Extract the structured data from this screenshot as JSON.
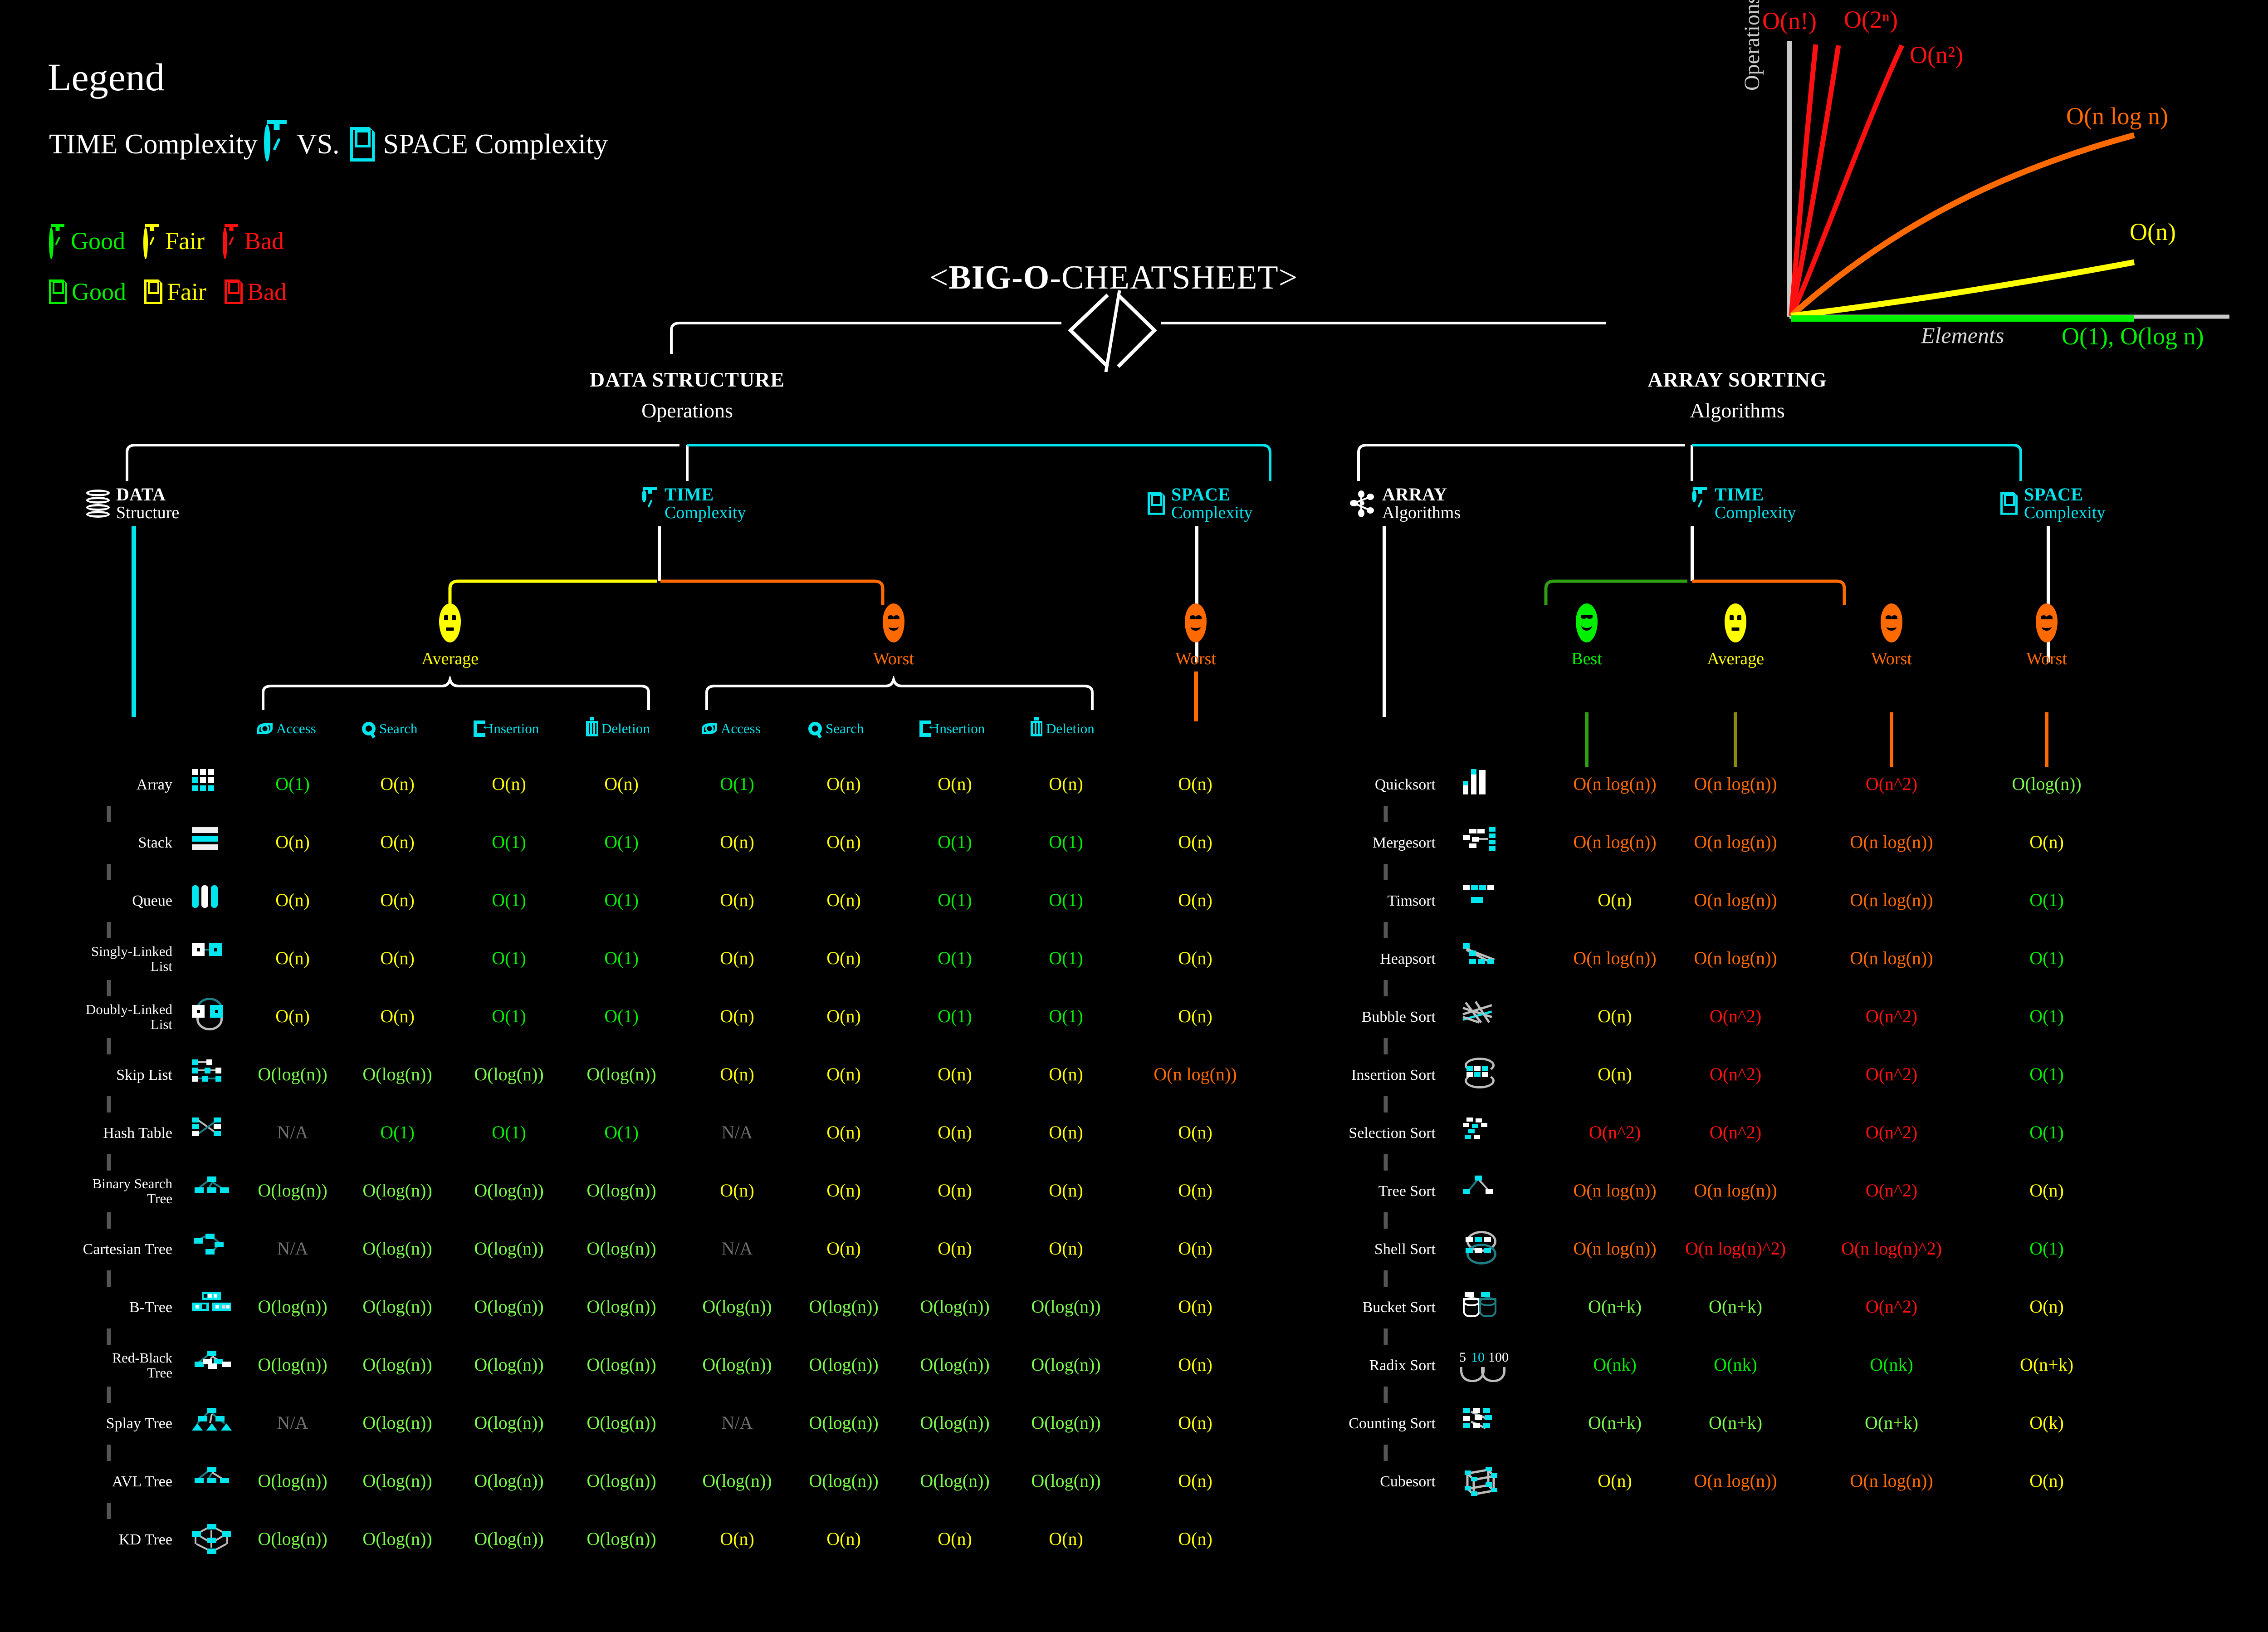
{
  "legend": {
    "title": "Legend",
    "time_label": "TIME Complexity",
    "vs": "VS.",
    "space_label": "SPACE Complexity",
    "time_icon": "stopwatch-icon",
    "space_icon": "floppy-disk-icon",
    "quality": [
      {
        "label": "Good",
        "color": "#00f000"
      },
      {
        "label": "Fair",
        "color": "#ffff00"
      },
      {
        "label": "Bad",
        "color": "#ff1010"
      }
    ]
  },
  "title": {
    "prefix": "<",
    "bold": "BIG-O",
    "rest": "-CHEATSHEET",
    "suffix": ">",
    "code_icon": "code-brackets-icon"
  },
  "chart_data": {
    "type": "line",
    "title": "",
    "xlabel": "Elements",
    "ylabel": "Operations",
    "grid": false,
    "legend_position": "inline-annotations",
    "series": [
      {
        "name": "O(n!)",
        "color": "#ff1010",
        "label_color": "#ff1010",
        "growth": "factorial"
      },
      {
        "name": "O(2ⁿ)",
        "color": "#ff1010",
        "label_color": "#ff1010",
        "growth": "exponential"
      },
      {
        "name": "O(n²)",
        "color": "#ff1010",
        "label_color": "#ff1010",
        "growth": "quadratic"
      },
      {
        "name": "O(n log n)",
        "color": "#ff6a00",
        "label_color": "#ff6a00",
        "growth": "linearithmic"
      },
      {
        "name": "O(n)",
        "color": "#ffff00",
        "label_color": "#ffff00",
        "growth": "linear"
      },
      {
        "name": "O(1), O(log n)",
        "color": "#00f000",
        "label_color": "#00f000",
        "growth": "constant"
      }
    ]
  },
  "data_structure": {
    "section_title": "DATA STRUCTURE",
    "section_sub": "Operations",
    "head_structure": {
      "t1": "DATA",
      "t2": "Structure",
      "icon": "database-drum-icon"
    },
    "head_time": {
      "t1": "TIME",
      "t2": "Complexity",
      "icon": "stopwatch-icon"
    },
    "head_space": {
      "t1": "SPACE",
      "t2": "Complexity",
      "icon": "floppy-disk-icon"
    },
    "cases": [
      {
        "label": "Average",
        "color": "#ffff00",
        "face": "neutral"
      },
      {
        "label": "Worst",
        "color": "#ff6a00",
        "face": "sad"
      },
      {
        "label": "Worst",
        "color": "#ff6a00",
        "face": "sad"
      }
    ],
    "operations": [
      "Access",
      "Search",
      "Insertion",
      "Deletion"
    ],
    "op_icons": [
      "eye-icon",
      "magnifier-icon",
      "insertion-icon",
      "deletion-icon"
    ],
    "space_col_label": "Worst",
    "rows": [
      {
        "name": "Array",
        "icon": "array-grid-icon",
        "avg": [
          "O(1)",
          "O(n)",
          "O(n)",
          "O(n)"
        ],
        "worst": [
          "O(1)",
          "O(n)",
          "O(n)",
          "O(n)"
        ],
        "space": "O(n)",
        "avg_c": [
          "g",
          "y",
          "y",
          "y"
        ],
        "worst_c": [
          "g",
          "y",
          "y",
          "y"
        ],
        "space_c": "y"
      },
      {
        "name": "Stack",
        "icon": "stack-icon",
        "avg": [
          "O(n)",
          "O(n)",
          "O(1)",
          "O(1)"
        ],
        "worst": [
          "O(n)",
          "O(n)",
          "O(1)",
          "O(1)"
        ],
        "space": "O(n)",
        "avg_c": [
          "y",
          "y",
          "g",
          "g"
        ],
        "worst_c": [
          "y",
          "y",
          "g",
          "g"
        ],
        "space_c": "y"
      },
      {
        "name": "Queue",
        "icon": "queue-icon",
        "avg": [
          "O(n)",
          "O(n)",
          "O(1)",
          "O(1)"
        ],
        "worst": [
          "O(n)",
          "O(n)",
          "O(1)",
          "O(1)"
        ],
        "space": "O(n)",
        "avg_c": [
          "y",
          "y",
          "g",
          "g"
        ],
        "worst_c": [
          "y",
          "y",
          "g",
          "g"
        ],
        "space_c": "y"
      },
      {
        "name": "Singly-Linked\nList",
        "icon": "singly-linked-list-icon",
        "avg": [
          "O(n)",
          "O(n)",
          "O(1)",
          "O(1)"
        ],
        "worst": [
          "O(n)",
          "O(n)",
          "O(1)",
          "O(1)"
        ],
        "space": "O(n)",
        "avg_c": [
          "y",
          "y",
          "g",
          "g"
        ],
        "worst_c": [
          "y",
          "y",
          "g",
          "g"
        ],
        "space_c": "y"
      },
      {
        "name": "Doubly-Linked\nList",
        "icon": "doubly-linked-list-icon",
        "avg": [
          "O(n)",
          "O(n)",
          "O(1)",
          "O(1)"
        ],
        "worst": [
          "O(n)",
          "O(n)",
          "O(1)",
          "O(1)"
        ],
        "space": "O(n)",
        "avg_c": [
          "y",
          "y",
          "g",
          "g"
        ],
        "worst_c": [
          "y",
          "y",
          "g",
          "g"
        ],
        "space_c": "y"
      },
      {
        "name": "Skip List",
        "icon": "skip-list-icon",
        "avg": [
          "O(log(n))",
          "O(log(n))",
          "O(log(n))",
          "O(log(n))"
        ],
        "worst": [
          "O(n)",
          "O(n)",
          "O(n)",
          "O(n)"
        ],
        "space": "O(n log(n))",
        "avg_c": [
          "lg",
          "lg",
          "lg",
          "lg"
        ],
        "worst_c": [
          "y",
          "y",
          "y",
          "y"
        ],
        "space_c": "o"
      },
      {
        "name": "Hash Table",
        "icon": "hash-table-icon",
        "avg": [
          "N/A",
          "O(1)",
          "O(1)",
          "O(1)"
        ],
        "worst": [
          "N/A",
          "O(n)",
          "O(n)",
          "O(n)"
        ],
        "space": "O(n)",
        "avg_c": [
          "na",
          "g",
          "g",
          "g"
        ],
        "worst_c": [
          "na",
          "y",
          "y",
          "y"
        ],
        "space_c": "y"
      },
      {
        "name": "Binary Search\nTree",
        "icon": "binary-search-tree-icon",
        "avg": [
          "O(log(n))",
          "O(log(n))",
          "O(log(n))",
          "O(log(n))"
        ],
        "worst": [
          "O(n)",
          "O(n)",
          "O(n)",
          "O(n)"
        ],
        "space": "O(n)",
        "avg_c": [
          "lg",
          "lg",
          "lg",
          "lg"
        ],
        "worst_c": [
          "y",
          "y",
          "y",
          "y"
        ],
        "space_c": "y"
      },
      {
        "name": "Cartesian Tree",
        "icon": "cartesian-tree-icon",
        "avg": [
          "N/A",
          "O(log(n))",
          "O(log(n))",
          "O(log(n))"
        ],
        "worst": [
          "N/A",
          "O(n)",
          "O(n)",
          "O(n)"
        ],
        "space": "O(n)",
        "avg_c": [
          "na",
          "lg",
          "lg",
          "lg"
        ],
        "worst_c": [
          "na",
          "y",
          "y",
          "y"
        ],
        "space_c": "y"
      },
      {
        "name": "B-Tree",
        "icon": "b-tree-icon",
        "avg": [
          "O(log(n))",
          "O(log(n))",
          "O(log(n))",
          "O(log(n))"
        ],
        "worst": [
          "O(log(n))",
          "O(log(n))",
          "O(log(n))",
          "O(log(n))"
        ],
        "space": "O(n)",
        "avg_c": [
          "lg",
          "lg",
          "lg",
          "lg"
        ],
        "worst_c": [
          "lg",
          "lg",
          "lg",
          "lg"
        ],
        "space_c": "y"
      },
      {
        "name": "Red-Black\nTree",
        "icon": "red-black-tree-icon",
        "avg": [
          "O(log(n))",
          "O(log(n))",
          "O(log(n))",
          "O(log(n))"
        ],
        "worst": [
          "O(log(n))",
          "O(log(n))",
          "O(log(n))",
          "O(log(n))"
        ],
        "space": "O(n)",
        "avg_c": [
          "lg",
          "lg",
          "lg",
          "lg"
        ],
        "worst_c": [
          "lg",
          "lg",
          "lg",
          "lg"
        ],
        "space_c": "y"
      },
      {
        "name": "Splay Tree",
        "icon": "splay-tree-icon",
        "avg": [
          "N/A",
          "O(log(n))",
          "O(log(n))",
          "O(log(n))"
        ],
        "worst": [
          "N/A",
          "O(log(n))",
          "O(log(n))",
          "O(log(n))"
        ],
        "space": "O(n)",
        "avg_c": [
          "na",
          "lg",
          "lg",
          "lg"
        ],
        "worst_c": [
          "na",
          "lg",
          "lg",
          "lg"
        ],
        "space_c": "y"
      },
      {
        "name": "AVL Tree",
        "icon": "avl-tree-icon",
        "avg": [
          "O(log(n))",
          "O(log(n))",
          "O(log(n))",
          "O(log(n))"
        ],
        "worst": [
          "O(log(n))",
          "O(log(n))",
          "O(log(n))",
          "O(log(n))"
        ],
        "space": "O(n)",
        "avg_c": [
          "lg",
          "lg",
          "lg",
          "lg"
        ],
        "worst_c": [
          "lg",
          "lg",
          "lg",
          "lg"
        ],
        "space_c": "y"
      },
      {
        "name": "KD Tree",
        "icon": "kd-tree-icon",
        "avg": [
          "O(log(n))",
          "O(log(n))",
          "O(log(n))",
          "O(log(n))"
        ],
        "worst": [
          "O(n)",
          "O(n)",
          "O(n)",
          "O(n)"
        ],
        "space": "O(n)",
        "avg_c": [
          "lg",
          "lg",
          "lg",
          "lg"
        ],
        "worst_c": [
          "y",
          "y",
          "y",
          "y"
        ],
        "space_c": "y"
      }
    ]
  },
  "array_sorting": {
    "section_title": "ARRAY SORTING",
    "section_sub": "Algorithms",
    "head_array": {
      "t1": "ARRAY",
      "t2": "Algorithms",
      "icon": "array-nodes-icon"
    },
    "head_time": {
      "t1": "TIME",
      "t2": "Complexity",
      "icon": "stopwatch-icon"
    },
    "head_space": {
      "t1": "SPACE",
      "t2": "Complexity",
      "icon": "floppy-disk-icon"
    },
    "cases": [
      {
        "label": "Best",
        "color": "#00f000",
        "face": "happy"
      },
      {
        "label": "Average",
        "color": "#ffff00",
        "face": "neutral"
      },
      {
        "label": "Worst",
        "color": "#ff6a00",
        "face": "sad"
      },
      {
        "label": "Worst",
        "color": "#ff6a00",
        "face": "sad"
      }
    ],
    "rows": [
      {
        "name": "Quicksort",
        "icon": "quicksort-bars-icon",
        "vals": [
          "O(n log(n))",
          "O(n log(n))",
          "O(n^2)",
          "O(log(n))"
        ],
        "cols": [
          "o",
          "o",
          "r",
          "lg"
        ]
      },
      {
        "name": "Mergesort",
        "icon": "mergesort-icon",
        "vals": [
          "O(n log(n))",
          "O(n log(n))",
          "O(n log(n))",
          "O(n)"
        ],
        "cols": [
          "o",
          "o",
          "o",
          "y"
        ]
      },
      {
        "name": "Timsort",
        "icon": "timsort-icon",
        "vals": [
          "O(n)",
          "O(n log(n))",
          "O(n log(n))",
          "O(1)"
        ],
        "cols": [
          "y",
          "o",
          "o",
          "g"
        ]
      },
      {
        "name": "Heapsort",
        "icon": "heapsort-icon",
        "vals": [
          "O(n log(n))",
          "O(n log(n))",
          "O(n log(n))",
          "O(1)"
        ],
        "cols": [
          "o",
          "o",
          "o",
          "g"
        ]
      },
      {
        "name": "Bubble Sort",
        "icon": "bubble-sort-icon",
        "vals": [
          "O(n)",
          "O(n^2)",
          "O(n^2)",
          "O(1)"
        ],
        "cols": [
          "y",
          "r",
          "r",
          "g"
        ]
      },
      {
        "name": "Insertion Sort",
        "icon": "insertion-sort-icon",
        "vals": [
          "O(n)",
          "O(n^2)",
          "O(n^2)",
          "O(1)"
        ],
        "cols": [
          "y",
          "r",
          "r",
          "g"
        ]
      },
      {
        "name": "Selection Sort",
        "icon": "selection-sort-icon",
        "vals": [
          "O(n^2)",
          "O(n^2)",
          "O(n^2)",
          "O(1)"
        ],
        "cols": [
          "r",
          "r",
          "r",
          "g"
        ]
      },
      {
        "name": "Tree Sort",
        "icon": "tree-sort-icon",
        "vals": [
          "O(n log(n))",
          "O(n log(n))",
          "O(n^2)",
          "O(n)"
        ],
        "cols": [
          "o",
          "o",
          "r",
          "y"
        ]
      },
      {
        "name": "Shell Sort",
        "icon": "shell-sort-icon",
        "vals": [
          "O(n log(n))",
          "O(n log(n)^2)",
          "O(n log(n)^2)",
          "O(1)"
        ],
        "cols": [
          "o",
          "r",
          "r",
          "g"
        ]
      },
      {
        "name": "Bucket Sort",
        "icon": "bucket-sort-icon",
        "vals": [
          "O(n+k)",
          "O(n+k)",
          "O(n^2)",
          "O(n)"
        ],
        "cols": [
          "lg",
          "lg",
          "r",
          "y"
        ]
      },
      {
        "name": "Radix Sort",
        "icon": "radix-sort-icon",
        "vals": [
          "O(nk)",
          "O(nk)",
          "O(nk)",
          "O(n+k)"
        ],
        "cols": [
          "g",
          "g",
          "g",
          "y"
        ]
      },
      {
        "name": "Counting Sort",
        "icon": "counting-sort-icon",
        "vals": [
          "O(n+k)",
          "O(n+k)",
          "O(n+k)",
          "O(k)"
        ],
        "cols": [
          "lg",
          "lg",
          "lg",
          "y"
        ]
      },
      {
        "name": "Cubesort",
        "icon": "cubesort-icon",
        "vals": [
          "O(n)",
          "O(n log(n))",
          "O(n log(n))",
          "O(n)"
        ],
        "cols": [
          "y",
          "o",
          "o",
          "y"
        ]
      }
    ],
    "radix_icon_digits": [
      "5",
      "10",
      "100"
    ]
  }
}
